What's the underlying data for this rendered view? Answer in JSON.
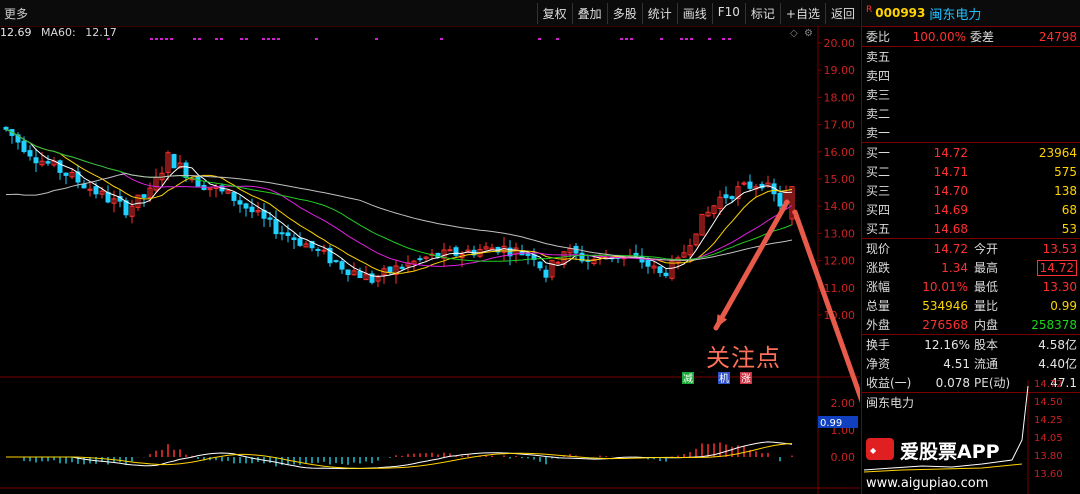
{
  "toolbar": {
    "more": "更多",
    "buttons": [
      "复权",
      "叠加",
      "多股",
      "统计",
      "画线",
      "F10",
      "标记",
      "+自选",
      "返回"
    ]
  },
  "ma": {
    "ma_partial": "12.69",
    "ma60_label": "MA60:",
    "ma60_value": "12.17"
  },
  "price_axis": [
    "20.00",
    "19.00",
    "18.00",
    "17.00",
    "16.00",
    "15.00",
    "14.00",
    "13.00",
    "12.00",
    "11.00",
    "10.00"
  ],
  "macd_axis": [
    "2.00",
    "1.00",
    "0.00"
  ],
  "macd_tag": "0.99",
  "signals": {
    "jian": "减",
    "mid": "机",
    "zhang": "涨"
  },
  "annotation": "关注点",
  "stock": {
    "r_mark": "R",
    "code": "000993",
    "name": "闽东电力"
  },
  "weibi": {
    "label1": "委比",
    "value1": "100.00%",
    "label2": "委差",
    "value2": "24798"
  },
  "sell": [
    {
      "label": "卖五",
      "price": "",
      "vol": ""
    },
    {
      "label": "卖四",
      "price": "",
      "vol": ""
    },
    {
      "label": "卖三",
      "price": "",
      "vol": ""
    },
    {
      "label": "卖二",
      "price": "",
      "vol": ""
    },
    {
      "label": "卖一",
      "price": "",
      "vol": ""
    }
  ],
  "buy": [
    {
      "label": "买一",
      "price": "14.72",
      "vol": "23964"
    },
    {
      "label": "买二",
      "price": "14.71",
      "vol": "575"
    },
    {
      "label": "买三",
      "price": "14.70",
      "vol": "138"
    },
    {
      "label": "买四",
      "price": "14.69",
      "vol": "68"
    },
    {
      "label": "买五",
      "price": "14.68",
      "vol": "53"
    }
  ],
  "quote": [
    {
      "l1": "现价",
      "v1": "14.72",
      "c1": "red",
      "l2": "今开",
      "v2": "13.53",
      "c2": "red"
    },
    {
      "l1": "涨跌",
      "v1": "1.34",
      "c1": "red",
      "l2": "最高",
      "v2": "14.72",
      "c2": "red"
    },
    {
      "l1": "涨幅",
      "v1": "10.01%",
      "c1": "red",
      "l2": "最低",
      "v2": "13.30",
      "c2": "red"
    },
    {
      "l1": "总量",
      "v1": "534946",
      "c1": "yellow",
      "l2": "量比",
      "v2": "0.99",
      "c2": "yellow"
    },
    {
      "l1": "外盘",
      "v1": "276568",
      "c1": "red",
      "l2": "内盘",
      "v2": "258378",
      "c2": "green"
    }
  ],
  "fund": [
    {
      "l1": "换手",
      "v1": "12.16%",
      "l2": "股本",
      "v2": "4.58亿"
    },
    {
      "l1": "净资",
      "v1": "4.51",
      "l2": "流通",
      "v2": "4.40亿"
    },
    {
      "l1": "收益(一)",
      "v1": "0.078",
      "l2": "PE(动)",
      "v2": "47.1"
    }
  ],
  "mini": {
    "title": "闽东电力",
    "axis": [
      "14.72",
      "14.50",
      "14.25",
      "14.05",
      "13.80",
      "13.60"
    ]
  },
  "watermark": {
    "brand": "爱股票APP",
    "url": "www.aigupiao.com"
  },
  "colors": {
    "up": "#ff3030",
    "down": "#20d0ff",
    "ma5": "#ffffff",
    "ma10": "#ffd400",
    "ma20": "#e020e0",
    "ma30": "#22cc22",
    "ma60": "#c0c0c0",
    "arrow": "#e85a4a"
  }
}
